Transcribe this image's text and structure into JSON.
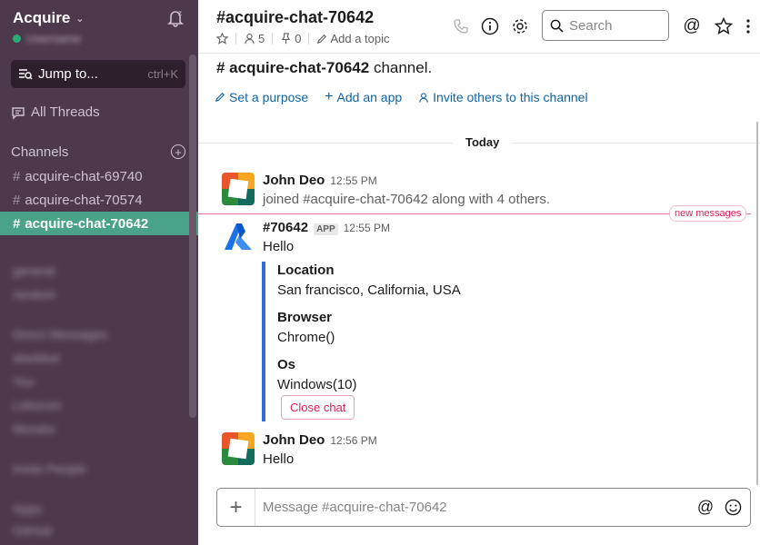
{
  "workspace": {
    "name": "Acquire",
    "user": "Username"
  },
  "sidebar": {
    "jump_label": "Jump to...",
    "jump_shortcut": "ctrl+K",
    "all_threads": "All Threads",
    "channels_title": "Channels",
    "add_channel_icon": "plus-circle-icon",
    "channels": [
      {
        "name": "acquire-chat-69740",
        "active": false
      },
      {
        "name": "acquire-chat-70574",
        "active": false
      },
      {
        "name": "acquire-chat-70642",
        "active": true
      }
    ],
    "blurred": [
      "general",
      "random",
      "Direct Messages",
      "slackbot",
      "You",
      "Leksrom",
      "Mondor",
      "Invite People",
      "Apps",
      "GitHub"
    ]
  },
  "header": {
    "title": "#acquire-chat-70642",
    "members": "5",
    "pins": "0",
    "add_topic": "Add a topic",
    "search_placeholder": "Search"
  },
  "main": {
    "intro_name": "# acquire-chat-70642",
    "intro_suffix": "channel.",
    "actions": [
      "Set a purpose",
      "Add an app",
      "Invite others to this channel"
    ],
    "day": "Today",
    "new_messages": "new messages",
    "messages": [
      {
        "author": "John Deo",
        "time": "12:55 PM",
        "text": "joined #acquire-chat-70642 along with 4 others."
      },
      {
        "author": "#70642",
        "badge": "APP",
        "time": "12:55 PM",
        "text": "Hello"
      },
      {
        "author": "John Deo",
        "time": "12:56 PM",
        "text": "Hello"
      }
    ],
    "attachment": {
      "fields": [
        {
          "title": "Location",
          "value": "San francisco, California, USA"
        },
        {
          "title": "Browser",
          "value": "Chrome()"
        },
        {
          "title": "Os",
          "value": "Windows(10)"
        }
      ],
      "button": "Close chat"
    }
  },
  "composer": {
    "placeholder": "Message #acquire-chat-70642"
  },
  "colors": {
    "sidebar": "#4d394b",
    "active_channel": "#4aa388",
    "link": "#1264a3",
    "new_messages": "#e01e5a",
    "attachment_bar": "#2d6bdf"
  }
}
